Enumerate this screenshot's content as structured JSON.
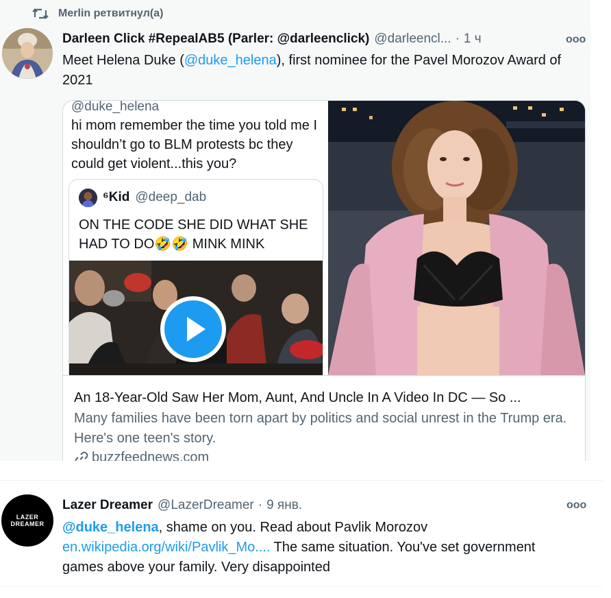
{
  "retweet": {
    "label": "Merlin ретвитнул(а)"
  },
  "tweet1": {
    "name": "Darleen Click #RepealAB5 (Parler: @darleenclick)",
    "handle": "@darleencl...",
    "separator": "·",
    "time": "1 ч",
    "more": "ooo",
    "text_before": "Meet Helena Duke (",
    "mention": "@duke_helena",
    "text_after": "), first nominee for the Pavel Morozov Award of 2021",
    "card": {
      "quoted_handle": "@duke_helena",
      "quoted_text": "hi mom remember the time you told me I shouldn’t go to BLM protests bc they could get violent...this you?",
      "inner": {
        "name": "⁶Kid",
        "handle": "@deep_dab",
        "text": "ON THE CODE SHE DID WHAT SHE HAD TO DO🤣🤣 MINK MINK"
      },
      "title": "An 18-Year-Old Saw Her Mom, Aunt, And Uncle In A Video In DC — So ...",
      "description": "Many families have been torn apart by politics and social unrest in the Trump era. Here's one teen's story.",
      "domain": "buzzfeednews.com"
    }
  },
  "tweet2": {
    "avatar_line1": "LAZER",
    "avatar_line2": "DREAMER",
    "name": "Lazer Dreamer",
    "handle": "@LazerDreamer",
    "separator": "·",
    "time": "9 янв.",
    "more": "ooo",
    "mention": "@duke_helena",
    "text_1": ", shame on you. Read about Pavlik Morozov",
    "link": "en.wikipedia.org/wiki/Pavlik_Mo....",
    "text_2": " The same situation. You've set government games above your family. Very disappointed"
  },
  "colors": {
    "accent": "#1d9bf0",
    "secondary_text": "#536471",
    "primary_text": "#0f1419",
    "retweet_bg": "#f7f9f9"
  },
  "icons": [
    "retweet-icon",
    "more-icon",
    "play-icon",
    "link-icon"
  ]
}
